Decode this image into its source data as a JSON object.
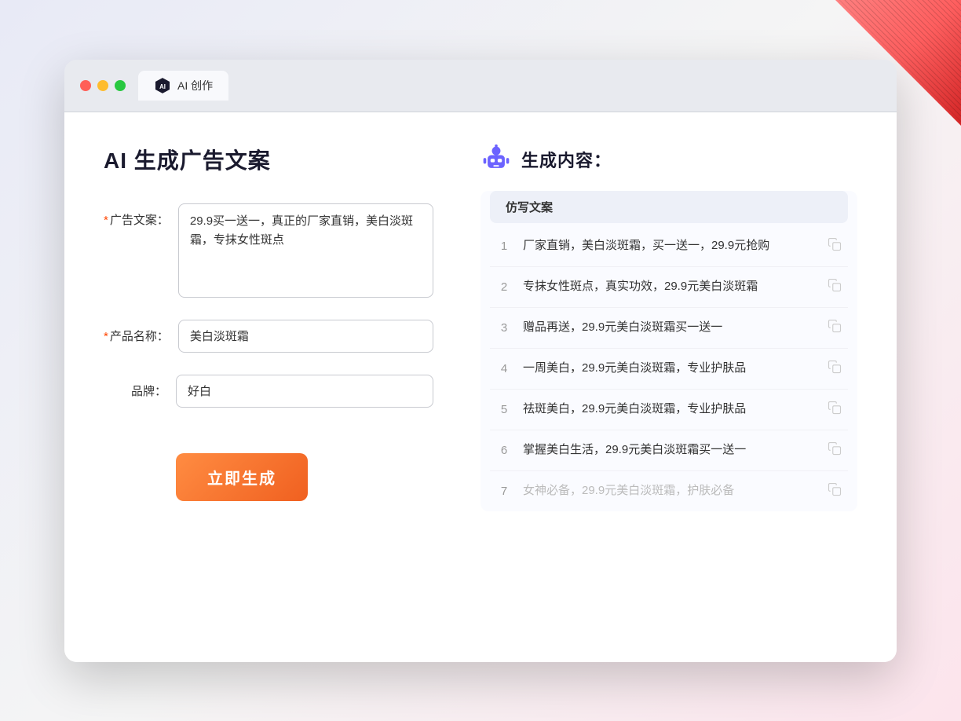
{
  "window": {
    "tab_label": "AI 创作"
  },
  "page": {
    "title": "AI 生成广告文案",
    "result_title": "生成内容："
  },
  "form": {
    "ad_copy_label": "广告文案：",
    "ad_copy_required": "*",
    "ad_copy_value": "29.9买一送一，真正的厂家直销，美白淡斑霜，专抹女性斑点",
    "product_name_label": "产品名称：",
    "product_name_required": "*",
    "product_name_value": "美白淡斑霜",
    "brand_label": "品牌：",
    "brand_value": "好白",
    "generate_button": "立即生成"
  },
  "results": {
    "table_header": "仿写文案",
    "items": [
      {
        "num": "1",
        "text": "厂家直销，美白淡斑霜，买一送一，29.9元抢购",
        "dimmed": false
      },
      {
        "num": "2",
        "text": "专抹女性斑点，真实功效，29.9元美白淡斑霜",
        "dimmed": false
      },
      {
        "num": "3",
        "text": "赠品再送，29.9元美白淡斑霜买一送一",
        "dimmed": false
      },
      {
        "num": "4",
        "text": "一周美白，29.9元美白淡斑霜，专业护肤品",
        "dimmed": false
      },
      {
        "num": "5",
        "text": "祛斑美白，29.9元美白淡斑霜，专业护肤品",
        "dimmed": false
      },
      {
        "num": "6",
        "text": "掌握美白生活，29.9元美白淡斑霜买一送一",
        "dimmed": false
      },
      {
        "num": "7",
        "text": "女神必备，29.9元美白淡斑霜，护肤必备",
        "dimmed": true
      }
    ]
  }
}
